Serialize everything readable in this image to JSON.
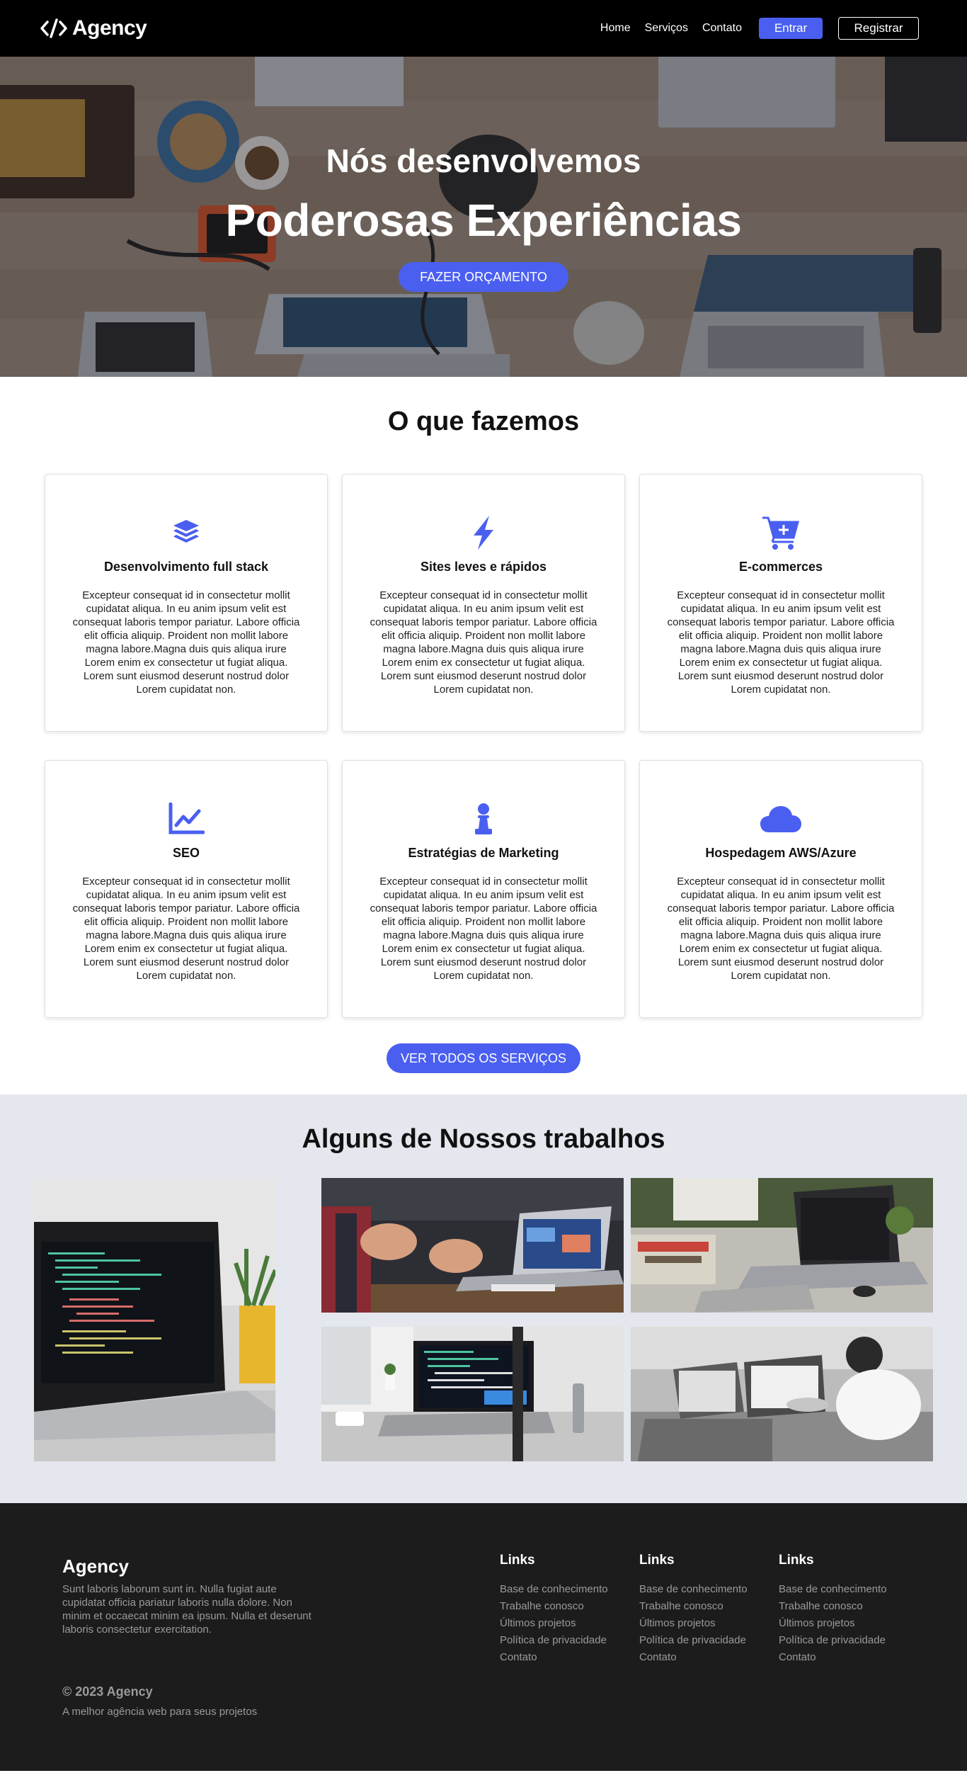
{
  "nav": {
    "brand": "Agency",
    "links": [
      "Home",
      "Serviços",
      "Contato"
    ],
    "login": "Entrar",
    "register": "Registrar"
  },
  "hero": {
    "subtitle": "Nós desenvolvemos",
    "title": "Poderosas Experiências",
    "cta": "FAZER ORÇAMENTO"
  },
  "services": {
    "title": "O que fazemos",
    "cards": [
      {
        "title": "Desenvolvimento full stack",
        "icon": "layers-icon",
        "text": "Excepteur consequat id in consectetur mollit cupidatat aliqua. In eu anim ipsum velit est consequat laboris tempor pariatur. Labore officia elit officia aliquip. Proident non mollit labore magna labore.Magna duis quis aliqua irure Lorem enim ex consectetur ut fugiat aliqua. Lorem sunt eiusmod deserunt nostrud dolor Lorem cupidatat non."
      },
      {
        "title": "Sites leves e rápidos",
        "icon": "bolt-icon",
        "text": "Excepteur consequat id in consectetur mollit cupidatat aliqua. In eu anim ipsum velit est consequat laboris tempor pariatur. Labore officia elit officia aliquip. Proident non mollit labore magna labore.Magna duis quis aliqua irure Lorem enim ex consectetur ut fugiat aliqua. Lorem sunt eiusmod deserunt nostrud dolor Lorem cupidatat non."
      },
      {
        "title": "E-commerces",
        "icon": "cart-plus-icon",
        "text": "Excepteur consequat id in consectetur mollit cupidatat aliqua. In eu anim ipsum velit est consequat laboris tempor pariatur. Labore officia elit officia aliquip. Proident non mollit labore magna labore.Magna duis quis aliqua irure Lorem enim ex consectetur ut fugiat aliqua. Lorem sunt eiusmod deserunt nostrud dolor Lorem cupidatat non."
      },
      {
        "title": "SEO",
        "icon": "chart-line-icon",
        "text": "Excepteur consequat id in consectetur mollit cupidatat aliqua. In eu anim ipsum velit est consequat laboris tempor pariatur. Labore officia elit officia aliquip. Proident non mollit labore magna labore.Magna duis quis aliqua irure Lorem enim ex consectetur ut fugiat aliqua. Lorem sunt eiusmod deserunt nostrud dolor Lorem cupidatat non."
      },
      {
        "title": "Estratégias de Marketing",
        "icon": "chess-pawn-icon",
        "text": "Excepteur consequat id in consectetur mollit cupidatat aliqua. In eu anim ipsum velit est consequat laboris tempor pariatur. Labore officia elit officia aliquip. Proident non mollit labore magna labore.Magna duis quis aliqua irure Lorem enim ex consectetur ut fugiat aliqua. Lorem sunt eiusmod deserunt nostrud dolor Lorem cupidatat non."
      },
      {
        "title": "Hospedagem AWS/Azure",
        "icon": "cloud-icon",
        "text": "Excepteur consequat id in consectetur mollit cupidatat aliqua. In eu anim ipsum velit est consequat laboris tempor pariatur. Labore officia elit officia aliquip. Proident non mollit labore magna labore.Magna duis quis aliqua irure Lorem enim ex consectetur ut fugiat aliqua. Lorem sunt eiusmod deserunt nostrud dolor Lorem cupidatat non."
      }
    ],
    "cta": "VER TODOS OS SERVIÇOS"
  },
  "works": {
    "title": "Alguns de Nossos trabalhos"
  },
  "footer": {
    "brand": "Agency",
    "description": "Sunt laboris laborum sunt in. Nulla fugiat aute cupidatat officia pariatur laboris nulla dolore. Non minim et occaecat minim ea ipsum. Nulla et deserunt laboris consectetur exercitation.",
    "columns": [
      {
        "title": "Links",
        "items": [
          "Base de conhecimento",
          "Trabalhe conosco",
          "Últimos projetos",
          "Política de privacidade",
          "Contato"
        ]
      },
      {
        "title": "Links",
        "items": [
          "Base de conhecimento",
          "Trabalhe conosco",
          "Últimos projetos",
          "Política de privacidade",
          "Contato"
        ]
      },
      {
        "title": "Links",
        "items": [
          "Base de conhecimento",
          "Trabalhe conosco",
          "Últimos projetos",
          "Política de privacidade",
          "Contato"
        ]
      }
    ],
    "copyright": "© 2023 Agency",
    "tagline": "A melhor agência web para seus projetos"
  },
  "colors": {
    "accent": "#4a5ff0",
    "nav_bg": "#000000",
    "works_bg": "#e5e7ef",
    "footer_bg": "#1c1c1c"
  }
}
